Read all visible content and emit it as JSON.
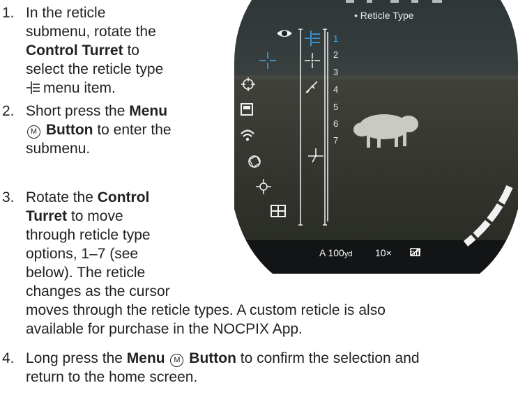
{
  "steps": [
    {
      "number": "1.",
      "line1": "In the reticle",
      "line2": "submenu, rotate the",
      "line3_bold": "Control Turret",
      "line3_rest": " to",
      "line4": "select the reticle type",
      "line5_rest": "menu item."
    },
    {
      "number": "2.",
      "line1_pre": "Short press the ",
      "line1_bold": "Menu",
      "line2_glyph": "M",
      "line2_bold": "Button",
      "line2_rest": " to enter the",
      "line3": "submenu."
    },
    {
      "number": "3.",
      "line1_pre": "Rotate the ",
      "line1_bold": "Control",
      "line2_bold": "Turret",
      "line2_rest": " to move",
      "line3": "through reticle type",
      "line4": "options, 1–7 (see",
      "line5": "below). The reticle",
      "line6": "changes as the cursor",
      "line7": "moves through the reticle types. A custom reticle is also",
      "line8": "available for purchase in the NOCPIX App."
    },
    {
      "number": "4.",
      "line1_pre": "Long press the ",
      "line1_bold": "Menu",
      "line1_glyph": "M",
      "line1_bold2": "Button",
      "line1_rest": " to confirm the selection and",
      "line2": "return to the home screen."
    }
  ],
  "screen": {
    "title": "• Reticle Type",
    "options": [
      "1",
      "2",
      "3",
      "4",
      "5",
      "6",
      "7"
    ],
    "selected_option": "1",
    "status": {
      "distance": "A 100",
      "distance_unit": "yd",
      "zoom": "10×",
      "pip": "off"
    },
    "menu_icons": [
      "eye-icon",
      "crosshair-icon",
      "target-icon",
      "save-icon",
      "wifi-icon",
      "aperture-icon",
      "calibration-icon",
      "pip-grid-icon"
    ],
    "colors": {
      "accent": "#3fa9f5",
      "text": "#e8e8e8"
    }
  }
}
